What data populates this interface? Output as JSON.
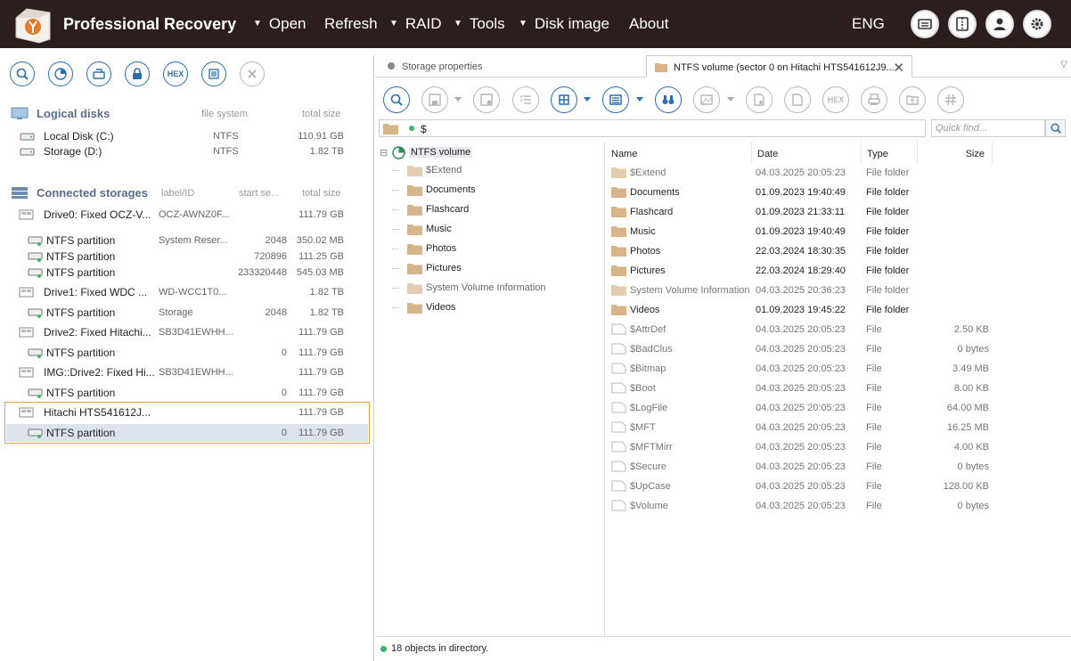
{
  "app": {
    "title": "Professional Recovery",
    "menu": [
      {
        "label": "Open",
        "has_caret": true
      },
      {
        "label": "Refresh",
        "has_caret": false
      },
      {
        "label": "RAID",
        "has_caret": true
      },
      {
        "label": "Tools",
        "has_caret": true
      },
      {
        "label": "Disk image",
        "has_caret": true
      },
      {
        "label": "About",
        "has_caret": false
      }
    ],
    "language": "ENG",
    "top_icons": [
      "messages-icon",
      "panel-toggle-icon",
      "user-icon",
      "settings-gear-icon"
    ]
  },
  "left_toolbar": {
    "buttons": [
      "search-icon",
      "scan-chart-icon",
      "disk-image-icon",
      "lock-icon",
      "HEX",
      "list-icon",
      "close-icon"
    ]
  },
  "logical_disks": {
    "title": "Logical disks",
    "col_fs": "file system",
    "col_size": "total size",
    "items": [
      {
        "name": "Local Disk (C:)",
        "fs": "NTFS",
        "size": "110.91 GB"
      },
      {
        "name": "Storage (D:)",
        "fs": "NTFS",
        "size": "1.82 TB"
      }
    ]
  },
  "connected_storages": {
    "title": "Connected storages",
    "col_label": "label/ID",
    "col_start": "start se...",
    "col_size": "total size",
    "items": [
      {
        "level": 0,
        "name": "Drive0: Fixed OCZ-V...",
        "label": "OCZ-AWNZ0F...",
        "start": "",
        "size": "111.79 GB"
      },
      {
        "level": 1,
        "name": "NTFS partition",
        "label": "System Reser...",
        "start": "2048",
        "size": "350.02 MB"
      },
      {
        "level": 1,
        "name": "NTFS partition",
        "label": "",
        "start": "720896",
        "size": "111.25 GB"
      },
      {
        "level": 1,
        "name": "NTFS partition",
        "label": "",
        "start": "233320448",
        "size": "545.03 MB"
      },
      {
        "level": 0,
        "name": "Drive1: Fixed WDC ...",
        "label": "WD-WCC1T0...",
        "start": "",
        "size": "1.82 TB"
      },
      {
        "level": 1,
        "name": "NTFS partition",
        "label": "Storage",
        "start": "2048",
        "size": "1.82 TB"
      },
      {
        "level": 0,
        "name": "Drive2: Fixed Hitachi...",
        "label": "SB3D41EWHH...",
        "start": "",
        "size": "111.79 GB"
      },
      {
        "level": 1,
        "name": "NTFS partition",
        "label": "",
        "start": "0",
        "size": "111.79 GB"
      },
      {
        "level": 0,
        "name": "IMG::Drive2: Fixed Hi...",
        "label": "SB3D41EWHH...",
        "start": "",
        "size": "111.79 GB"
      },
      {
        "level": 1,
        "name": "NTFS partition",
        "label": "",
        "start": "0",
        "size": "111.79 GB"
      },
      {
        "level": 0,
        "name": "Hitachi HTS541612J...",
        "label": "",
        "start": "",
        "size": "111.79 GB"
      },
      {
        "level": 1,
        "name": "NTFS partition",
        "label": "",
        "start": "0",
        "size": "111.79 GB"
      }
    ]
  },
  "tabs": [
    {
      "label": "Storage properties",
      "active": false
    },
    {
      "label": "NTFS volume (sector 0 on Hitachi HTS541612J9...",
      "active": true
    }
  ],
  "path": "$",
  "search_placeholder": "Quick find...",
  "tree": {
    "root": "NTFS volume",
    "children": [
      {
        "name": "$Extend",
        "dim": true
      },
      {
        "name": "Documents",
        "dim": false
      },
      {
        "name": "Flashcard",
        "dim": false
      },
      {
        "name": "Music",
        "dim": false
      },
      {
        "name": "Photos",
        "dim": false
      },
      {
        "name": "Pictures",
        "dim": false
      },
      {
        "name": "System Volume Information",
        "dim": true
      },
      {
        "name": "Videos",
        "dim": false
      }
    ]
  },
  "file_list": {
    "columns": [
      "Name",
      "Date",
      "Type",
      "Size"
    ],
    "rows": [
      {
        "name": "$Extend",
        "date": "04.03.2025 20:05:23",
        "type": "File folder",
        "size": "",
        "kind": "folder",
        "dim": true
      },
      {
        "name": "Documents",
        "date": "01.09.2023 19:40:49",
        "type": "File folder",
        "size": "",
        "kind": "folder",
        "dim": false
      },
      {
        "name": "Flashcard",
        "date": "01.09.2023 21:33:11",
        "type": "File folder",
        "size": "",
        "kind": "folder",
        "dim": false
      },
      {
        "name": "Music",
        "date": "01.09.2023 19:40:49",
        "type": "File folder",
        "size": "",
        "kind": "folder",
        "dim": false
      },
      {
        "name": "Photos",
        "date": "22.03.2024 18:30:35",
        "type": "File folder",
        "size": "",
        "kind": "folder",
        "dim": false
      },
      {
        "name": "Pictures",
        "date": "22.03.2024 18:29:40",
        "type": "File folder",
        "size": "",
        "kind": "folder",
        "dim": false
      },
      {
        "name": "System Volume Information",
        "date": "04.03.2025 20:36:23",
        "type": "File folder",
        "size": "",
        "kind": "folder",
        "dim": true
      },
      {
        "name": "Videos",
        "date": "01.09.2023 19:45:22",
        "type": "File folder",
        "size": "",
        "kind": "folder",
        "dim": false
      },
      {
        "name": "$AttrDef",
        "date": "04.03.2025 20:05:23",
        "type": "File",
        "size": "2.50 KB",
        "kind": "file",
        "dim": true
      },
      {
        "name": "$BadClus",
        "date": "04.03.2025 20:05:23",
        "type": "File",
        "size": "0 bytes",
        "kind": "file",
        "dim": true
      },
      {
        "name": "$Bitmap",
        "date": "04.03.2025 20:05:23",
        "type": "File",
        "size": "3.49 MB",
        "kind": "file",
        "dim": true
      },
      {
        "name": "$Boot",
        "date": "04.03.2025 20:05:23",
        "type": "File",
        "size": "8.00 KB",
        "kind": "file",
        "dim": true
      },
      {
        "name": "$LogFile",
        "date": "04.03.2025 20:05:23",
        "type": "File",
        "size": "64.00 MB",
        "kind": "file",
        "dim": true
      },
      {
        "name": "$MFT",
        "date": "04.03.2025 20:05:23",
        "type": "File",
        "size": "16.25 MB",
        "kind": "file",
        "dim": true
      },
      {
        "name": "$MFTMirr",
        "date": "04.03.2025 20:05:23",
        "type": "File",
        "size": "4.00 KB",
        "kind": "file",
        "dim": true
      },
      {
        "name": "$Secure",
        "date": "04.03.2025 20:05:23",
        "type": "File",
        "size": "0 bytes",
        "kind": "file",
        "dim": true
      },
      {
        "name": "$UpCase",
        "date": "04.03.2025 20:05:23",
        "type": "File",
        "size": "128.00 KB",
        "kind": "file",
        "dim": true
      },
      {
        "name": "$Volume",
        "date": "04.03.2025 20:05:23",
        "type": "File",
        "size": "0 bytes",
        "kind": "file",
        "dim": true
      }
    ]
  },
  "status": "18 objects in directory.",
  "colors": {
    "topbar": "#2d1e1e",
    "accent": "#2a6fb0",
    "selection_border": "#e8a43a",
    "selection_bg": "#dde3ec",
    "ok_green": "#3bb56b",
    "folder": "#d7b48a"
  }
}
